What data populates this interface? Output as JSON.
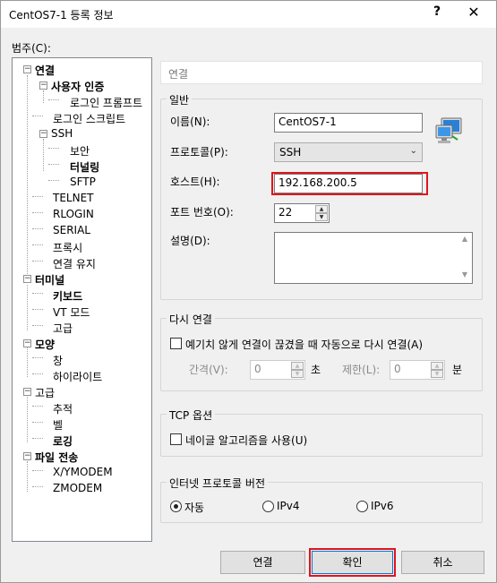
{
  "window": {
    "title": "CentOS7-1 등록 정보",
    "help": "?",
    "close": "✕"
  },
  "category_label": "범주(C):",
  "tree": {
    "items": [
      {
        "label": "연결"
      },
      {
        "label": "사용자 인증"
      },
      {
        "label": "로그인 프롬프트"
      },
      {
        "label": "로그인 스크립트"
      },
      {
        "label": "SSH"
      },
      {
        "label": "보안"
      },
      {
        "label": "터널링"
      },
      {
        "label": "SFTP"
      },
      {
        "label": "TELNET"
      },
      {
        "label": "RLOGIN"
      },
      {
        "label": "SERIAL"
      },
      {
        "label": "프록시"
      },
      {
        "label": "연결 유지"
      },
      {
        "label": "터미널"
      },
      {
        "label": "키보드"
      },
      {
        "label": "VT 모드"
      },
      {
        "label": "고급"
      },
      {
        "label": "모양"
      },
      {
        "label": "창"
      },
      {
        "label": "하이라이트"
      },
      {
        "label": "고급"
      },
      {
        "label": "추적"
      },
      {
        "label": "벨"
      },
      {
        "label": "로깅"
      },
      {
        "label": "파일 전송"
      },
      {
        "label": "X/YMODEM"
      },
      {
        "label": "ZMODEM"
      }
    ]
  },
  "page_header": "연결",
  "general": {
    "title": "일반",
    "name_label": "이름(N):",
    "name_value": "CentOS7-1",
    "protocol_label": "프로토콜(P):",
    "protocol_value": "SSH",
    "host_label": "호스트(H):",
    "host_value": "192.168.200.5",
    "port_label": "포트 번호(O):",
    "port_value": "22",
    "desc_label": "설명(D):"
  },
  "reconnect": {
    "title": "다시 연결",
    "checkbox_label": "예기치 않게 연결이 끊겼을 때 자동으로 다시 연결(A)",
    "interval_label": "간격(V):",
    "interval_value": "0",
    "interval_unit": "초",
    "limit_label": "제한(L):",
    "limit_value": "0",
    "limit_unit": "분"
  },
  "tcp": {
    "title": "TCP 옵션",
    "nagle_label": "네이글 알고리즘을 사용(U)"
  },
  "ipver": {
    "title": "인터넷 프로토콜 버전",
    "auto_label": "자동",
    "ipv4_label": "IPv4",
    "ipv6_label": "IPv6"
  },
  "buttons": {
    "connect": "연결",
    "ok": "확인",
    "cancel": "취소"
  },
  "highlight_color": "#e0141e"
}
